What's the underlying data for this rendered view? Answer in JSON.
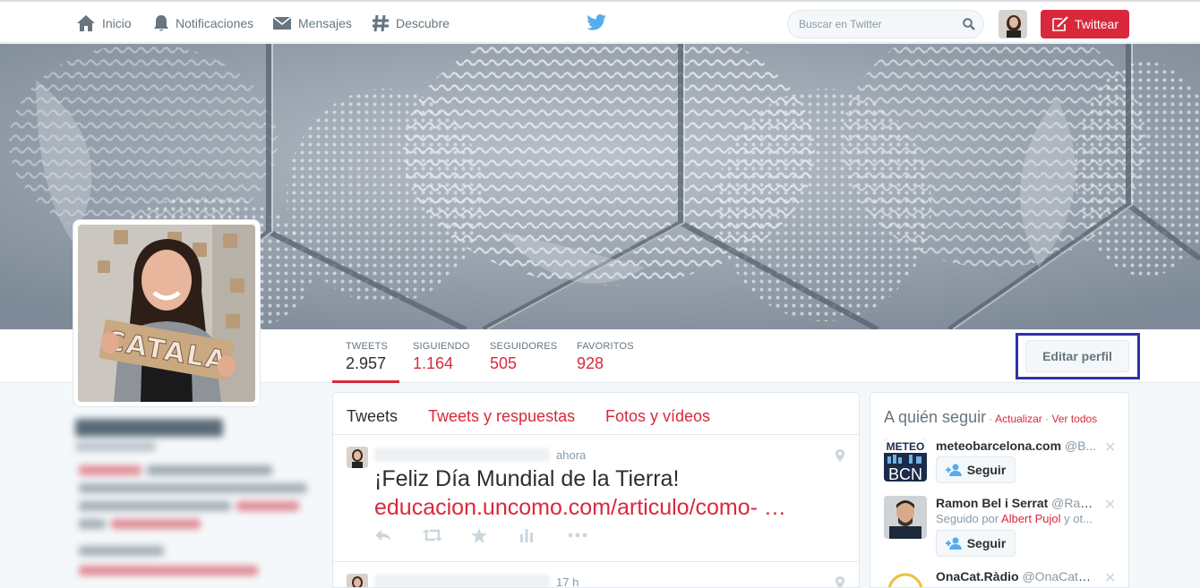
{
  "nav": {
    "items": [
      {
        "label": "Inicio",
        "icon": "home-icon"
      },
      {
        "label": "Notificaciones",
        "icon": "bell-icon"
      },
      {
        "label": "Mensajes",
        "icon": "envelope-icon"
      },
      {
        "label": "Descubre",
        "icon": "hashtag-icon"
      }
    ],
    "search_placeholder": "Buscar en Twitter",
    "tweet_button": "Twittear"
  },
  "profile": {
    "avatar_sign_text": "CATALA",
    "stats": [
      {
        "label": "TWEETS",
        "value": "2.957"
      },
      {
        "label": "SIGUIENDO",
        "value": "1.164"
      },
      {
        "label": "SEGUIDORES",
        "value": "505"
      },
      {
        "label": "FAVORITOS",
        "value": "928"
      }
    ],
    "edit_button": "Editar perfil"
  },
  "timeline": {
    "tabs": [
      "Tweets",
      "Tweets y respuestas",
      "Fotos y vídeos"
    ],
    "tweets": [
      {
        "time": "ahora",
        "text": "¡Feliz Día Mundial de la Tierra!",
        "link": "educacion.uncomo.com/articulo/como- …"
      },
      {
        "time": "17 h"
      }
    ]
  },
  "who_to_follow": {
    "title": "A quién seguir",
    "separator": " · ",
    "refresh": "Actualizar",
    "view_all": "Ver todos",
    "follow_label": "Seguir",
    "suggestions": [
      {
        "name": "meteobarcelona.com",
        "handle": "@B...",
        "avatar_text_top": "METEO",
        "avatar_text_bottom": "BCN"
      },
      {
        "name": "Ramon Bel i Serrat",
        "handle": "@Ram...",
        "context_prefix": "Seguido por",
        "context_user": "Albert Pujol",
        "context_suffix": "y ot..."
      },
      {
        "name": "OnaCat.Ràdio",
        "handle": "@OnaCatRa..."
      }
    ]
  },
  "colors": {
    "accent": "#d9283b",
    "highlight_frame": "#2e33a8",
    "bird": "#55acee"
  }
}
